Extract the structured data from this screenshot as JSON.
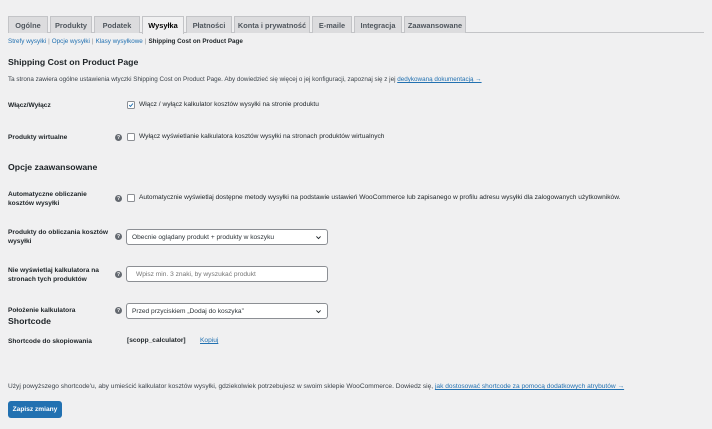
{
  "tabs": [
    {
      "label": "Ogólne"
    },
    {
      "label": "Produkty"
    },
    {
      "label": "Podatek"
    },
    {
      "label": "Wysyłka"
    },
    {
      "label": "Płatności"
    },
    {
      "label": "Konta i prywatność"
    },
    {
      "label": "E-maile"
    },
    {
      "label": "Integracja"
    },
    {
      "label": "Zaawansowane"
    }
  ],
  "active_tab": "Wysyłka",
  "subnav": {
    "items": [
      "Strefy wysyłki",
      "Opcje wysyłki",
      "Klasy wysyłkowe"
    ],
    "separator": "|",
    "current": "Shipping Cost on Product Page"
  },
  "page": {
    "title": "Shipping Cost on Product Page",
    "description": "Ta strona zawiera ogólne ustawienia wtyczki Shipping Cost on Product Page. Aby dowiedzieć się więcej o jej konfiguracji, zapoznaj się z jej ",
    "doc_link": "dedykowaną dokumentacją →"
  },
  "settings": {
    "enable": {
      "label": "Włącz/Wyłącz",
      "text": "Włącz / wyłącz kalkulator kosztów wysyłki na stronie produktu",
      "checked": true
    },
    "virtual": {
      "label": "Produkty wirtualne",
      "text": "Wyłącz wyświetlanie kalkulatora kosztów wysyłki na stronach produktów wirtualnych",
      "checked": false
    }
  },
  "advanced": {
    "title": "Opcje zaawansowane",
    "auto_calc": {
      "label": "Automatyczne obliczanie kosztów wysyłki",
      "text": "Automatycznie wyświetlaj dostępne metody wysyłki na podstawie ustawień WooCommerce lub zapisanego w profilu adresu wysyłki dla zalogowanych użytkowników.",
      "checked": false
    },
    "products_for_calc": {
      "label": "Produkty do obliczania kosztów wysyłki",
      "value": "Obecnie oglądany produkt + produkty w koszyku"
    },
    "hide_on": {
      "label": "Nie wyświetlaj kalkulatora na stronach tych produktów",
      "placeholder": "Wpisz min. 3 znaki, by wyszukać produkt"
    },
    "position": {
      "label": "Położenie kalkulatora",
      "value": "Przed przyciskiem „Dodaj do koszyka”"
    }
  },
  "shortcode": {
    "title": "Shortcode",
    "label": "Shortcode do skopiowania",
    "code": "[scopp_calculator]",
    "copy": "Kopiuj",
    "description": "Użyj powyższego shortcode'u, aby umieścić kalkulator kosztów wysyłki, gdziekolwiek potrzebujesz w swoim sklepie WooCommerce. Dowiedz się, ",
    "link": "jak dostosować shortcode za pomocą dodatkowych atrybutów →"
  },
  "save_button": "Zapisz zmiany",
  "colors": {
    "accent": "#2271b1",
    "background": "#f0f0f1",
    "tab_bg": "#dcdcde",
    "help_icon": "#646970"
  }
}
